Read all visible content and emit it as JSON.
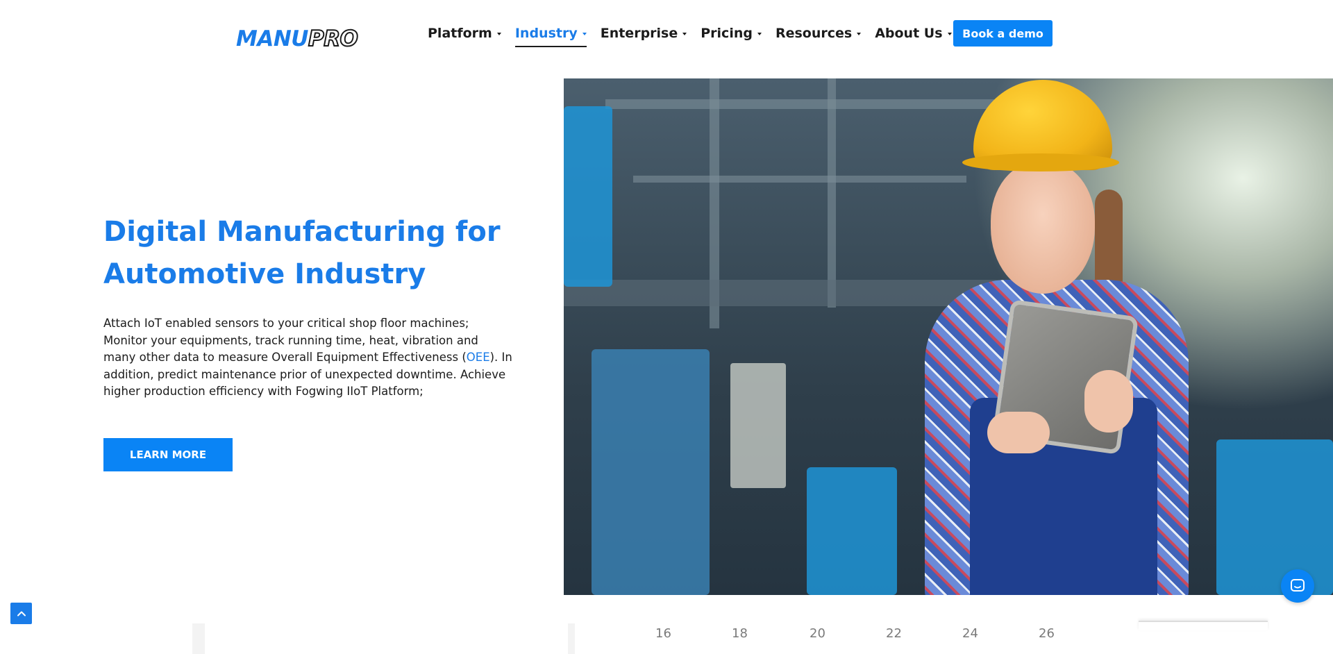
{
  "brand": {
    "logo_part1": "MANU",
    "logo_part2": "PRO",
    "brand_color": "#1a7ce8",
    "button_color": "#0a84f5"
  },
  "nav": {
    "items": [
      {
        "label": "Platform",
        "active": false
      },
      {
        "label": "Industry",
        "active": true
      },
      {
        "label": "Enterprise",
        "active": false
      },
      {
        "label": "Pricing",
        "active": false
      },
      {
        "label": "Resources",
        "active": false
      },
      {
        "label": "About Us",
        "active": false
      }
    ],
    "cta_label": "Book a demo"
  },
  "hero": {
    "title_line1": "Digital Manufacturing for",
    "title_line2": "Automotive Industry",
    "desc_before": "Attach IoT enabled sensors to your critical shop floor machines; Monitor your equipments, track running time, heat, vibration and many other data to measure Overall Equipment Effectiveness (",
    "desc_link": "OEE",
    "desc_after": "). In addition, predict maintenance prior of unexpected downtime.  Achieve higher production efficiency with Fogwing IIoT Platform;",
    "button_label": "LEARN MORE"
  },
  "timeline": {
    "ticks": [
      "16",
      "18",
      "20",
      "22",
      "24",
      "26"
    ]
  },
  "widgets": {
    "scroll_top_icon": "chevron-up-icon",
    "chat_icon": "chat-bubble-icon"
  }
}
